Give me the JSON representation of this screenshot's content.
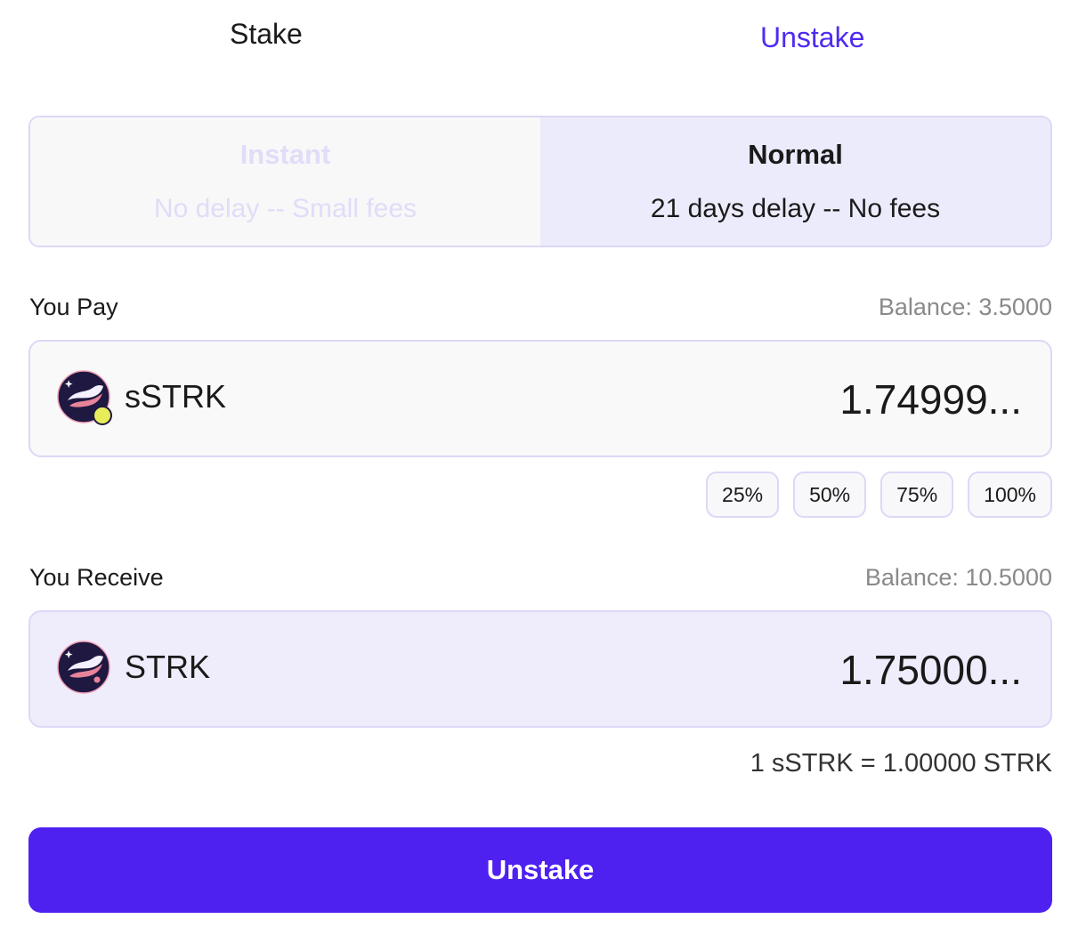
{
  "tabs": {
    "stake_label": "Stake",
    "unstake_label": "Unstake",
    "active": "Unstake"
  },
  "mode": {
    "selected": "Normal",
    "instant": {
      "title": "Instant",
      "subtitle": "No delay -- Small fees"
    },
    "normal": {
      "title": "Normal",
      "subtitle": "21 days delay -- No fees"
    }
  },
  "pay": {
    "label": "You Pay",
    "balance": "Balance: 3.5000",
    "token": "sSTRK",
    "amount": "1.74999...",
    "icon": "sstrk-logo-icon"
  },
  "percent_buttons": [
    "25%",
    "50%",
    "75%",
    "100%"
  ],
  "receive": {
    "label": "You Receive",
    "balance": "Balance: 10.5000",
    "token": "STRK",
    "amount": "1.75000...",
    "icon": "strk-logo-icon"
  },
  "rate": "1 sSTRK = 1.00000 STRK",
  "submit_label": "Unstake",
  "colors": {
    "accent": "#4e21f0",
    "tab_active": "#4f2bf0",
    "selected_bg": "#ecebfb"
  }
}
